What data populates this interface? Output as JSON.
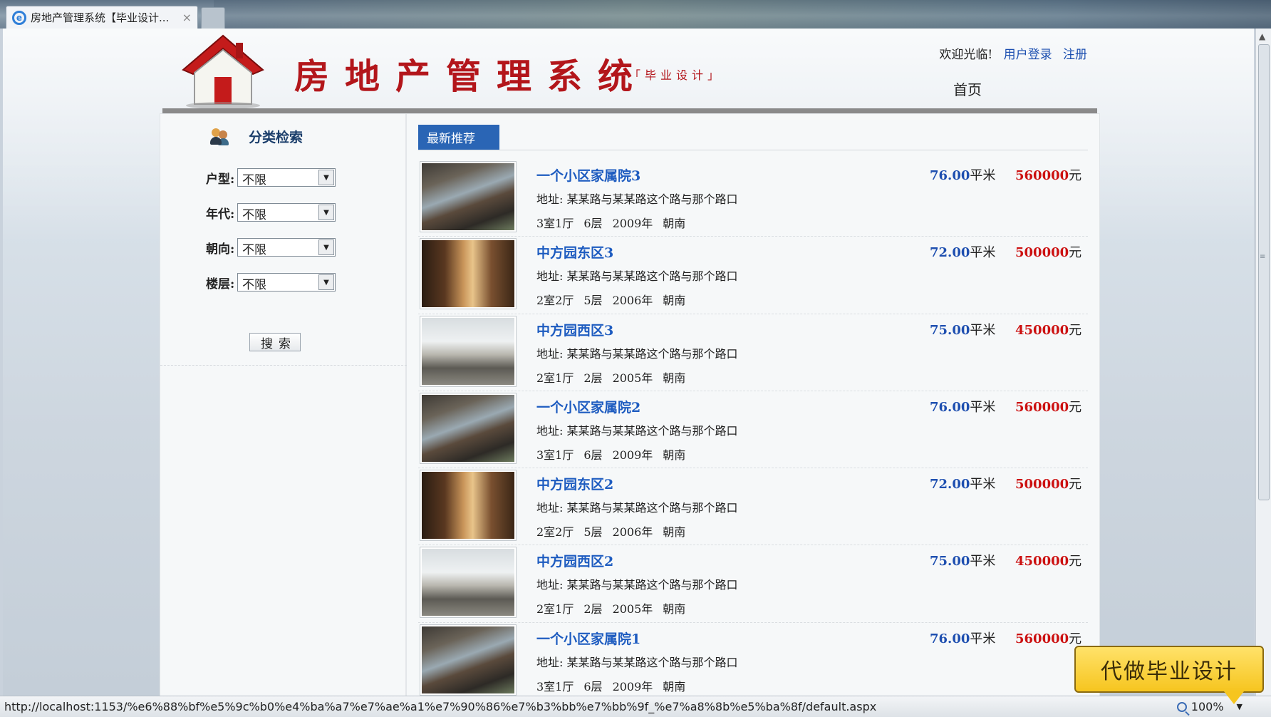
{
  "browser": {
    "tab_title": "房地产管理系统【毕业设计...",
    "tab_close": "×",
    "status_url": "http://localhost:1153/%e6%88%bf%e5%9c%b0%e4%ba%a7%e7%ae%a1%e7%90%86%e7%b3%bb%e7%bb%9f_%e7%a8%8b%e5%ba%8f/default.aspx",
    "zoom": "100%"
  },
  "header": {
    "title": "房地产管理系统",
    "subtitle": "「毕业设计」",
    "welcome": "欢迎光临!",
    "login": "用户登录",
    "register": "注册",
    "nav_home": "首页"
  },
  "sidebar": {
    "title": "分类检索",
    "filters": [
      {
        "label": "户型:",
        "value": "不限"
      },
      {
        "label": "年代:",
        "value": "不限"
      },
      {
        "label": "朝向:",
        "value": "不限"
      },
      {
        "label": "楼层:",
        "value": "不限"
      }
    ],
    "search_button": "搜索"
  },
  "main": {
    "tab": "最新推荐",
    "listings": [
      {
        "title": "一个小区家属院3",
        "address": "地址: 某某路与某某路这个路与那个路口",
        "layout": "3室1厅",
        "floor": "6层",
        "year": "2009年",
        "orientation": "朝南",
        "area": "76.00",
        "area_unit": "平米",
        "price": "560000",
        "price_unit": "元"
      },
      {
        "title": "中方园东区3",
        "address": "地址: 某某路与某某路这个路与那个路口",
        "layout": "2室2厅",
        "floor": "5层",
        "year": "2006年",
        "orientation": "朝南",
        "area": "72.00",
        "area_unit": "平米",
        "price": "500000",
        "price_unit": "元"
      },
      {
        "title": "中方园西区3",
        "address": "地址: 某某路与某某路这个路与那个路口",
        "layout": "2室1厅",
        "floor": "2层",
        "year": "2005年",
        "orientation": "朝南",
        "area": "75.00",
        "area_unit": "平米",
        "price": "450000",
        "price_unit": "元"
      },
      {
        "title": "一个小区家属院2",
        "address": "地址: 某某路与某某路这个路与那个路口",
        "layout": "3室1厅",
        "floor": "6层",
        "year": "2009年",
        "orientation": "朝南",
        "area": "76.00",
        "area_unit": "平米",
        "price": "560000",
        "price_unit": "元"
      },
      {
        "title": "中方园东区2",
        "address": "地址: 某某路与某某路这个路与那个路口",
        "layout": "2室2厅",
        "floor": "5层",
        "year": "2006年",
        "orientation": "朝南",
        "area": "72.00",
        "area_unit": "平米",
        "price": "500000",
        "price_unit": "元"
      },
      {
        "title": "中方园西区2",
        "address": "地址: 某某路与某某路这个路与那个路口",
        "layout": "2室1厅",
        "floor": "2层",
        "year": "2005年",
        "orientation": "朝南",
        "area": "75.00",
        "area_unit": "平米",
        "price": "450000",
        "price_unit": "元"
      },
      {
        "title": "一个小区家属院1",
        "address": "地址: 某某路与某某路这个路与那个路口",
        "layout": "3室1厅",
        "floor": "6层",
        "year": "2009年",
        "orientation": "朝南",
        "area": "76.00",
        "area_unit": "平米",
        "price": "560000",
        "price_unit": "元"
      }
    ]
  },
  "ad": {
    "text": "代做毕业设计"
  }
}
